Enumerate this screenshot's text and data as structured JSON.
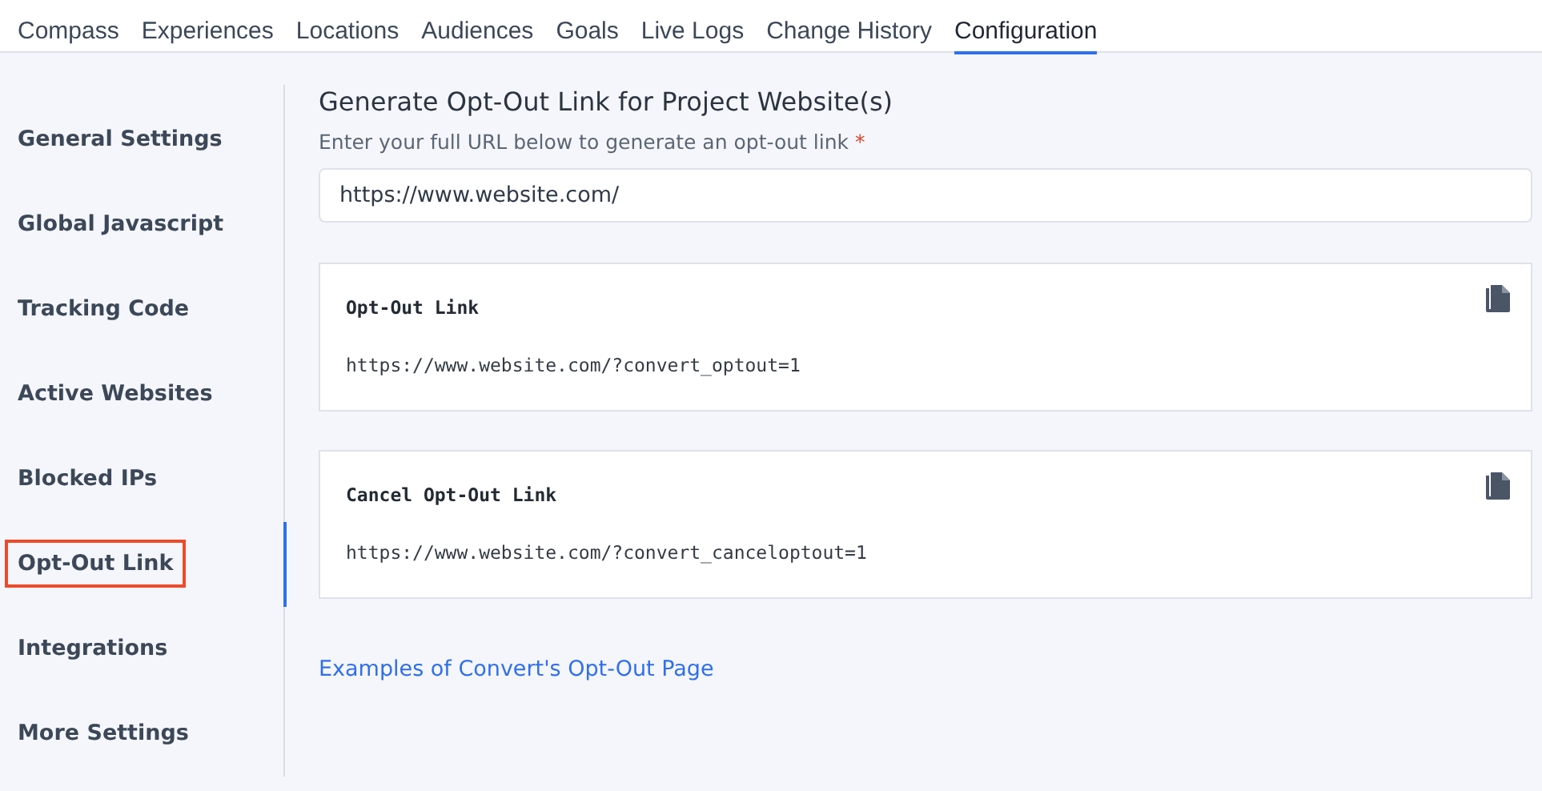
{
  "tabs": [
    {
      "label": "Compass",
      "selected": false
    },
    {
      "label": "Experiences",
      "selected": false
    },
    {
      "label": "Locations",
      "selected": false
    },
    {
      "label": "Audiences",
      "selected": false
    },
    {
      "label": "Goals",
      "selected": false
    },
    {
      "label": "Live Logs",
      "selected": false
    },
    {
      "label": "Change History",
      "selected": false
    },
    {
      "label": "Configuration",
      "selected": true
    }
  ],
  "sidebar": {
    "items": [
      {
        "label": "General Settings",
        "selected": false,
        "highlighted": false
      },
      {
        "label": "Global Javascript",
        "selected": false,
        "highlighted": false
      },
      {
        "label": "Tracking Code",
        "selected": false,
        "highlighted": false
      },
      {
        "label": "Active Websites",
        "selected": false,
        "highlighted": false
      },
      {
        "label": "Blocked IPs",
        "selected": false,
        "highlighted": false
      },
      {
        "label": "Opt-Out Link",
        "selected": true,
        "highlighted": true
      },
      {
        "label": "Integrations",
        "selected": false,
        "highlighted": false
      },
      {
        "label": "More Settings",
        "selected": false,
        "highlighted": false
      }
    ]
  },
  "main": {
    "title": "Generate Opt-Out Link for Project Website(s)",
    "field_label": "Enter your full URL below to generate an opt-out link",
    "required_mark": "*",
    "url_field": {
      "value": "https://www.website.com/"
    },
    "cards": [
      {
        "title": "Opt-Out Link",
        "url": "https://www.website.com/?convert_optout=1"
      },
      {
        "title": "Cancel Opt-Out Link",
        "url": "https://www.website.com/?convert_canceloptout=1"
      }
    ],
    "examples_link": "Examples of Convert's Opt-Out Page"
  }
}
